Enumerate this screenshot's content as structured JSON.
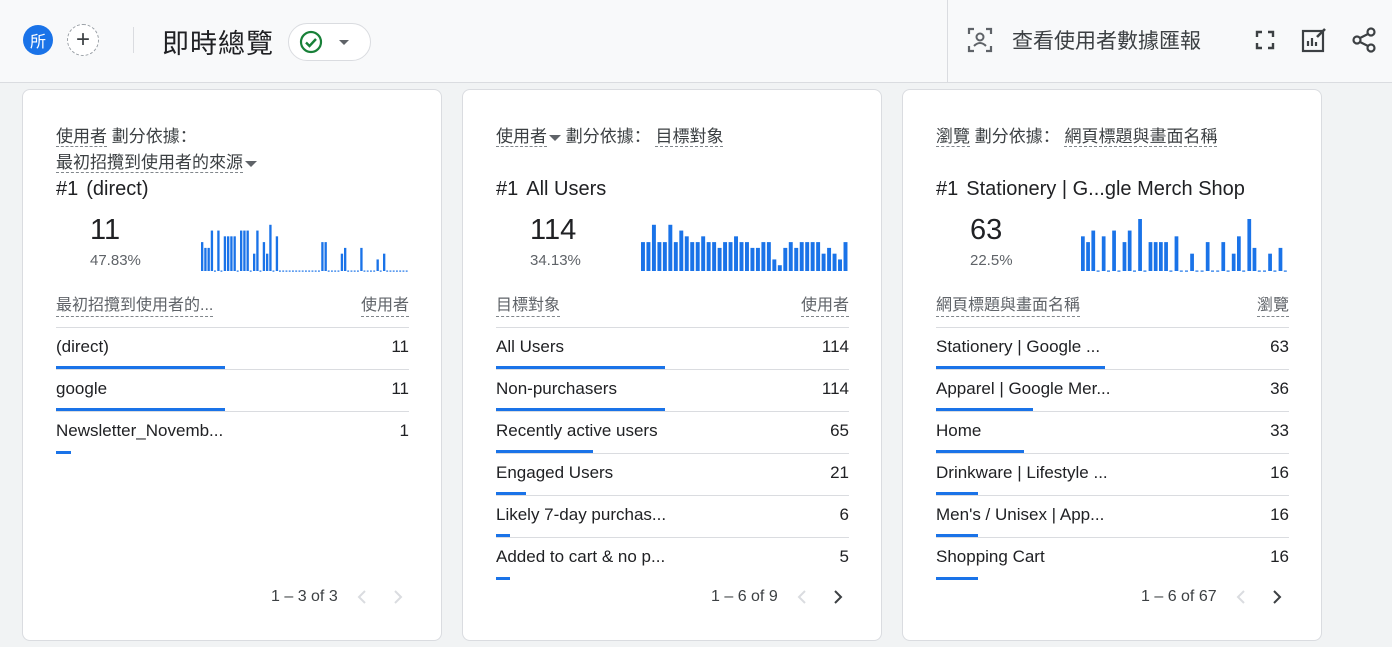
{
  "header": {
    "avatar_text": "所",
    "add_symbol": "+",
    "title": "即時總覽",
    "report_link": "查看使用者數據匯報"
  },
  "colors": {
    "accent": "#1a73e8",
    "check": "#188038"
  },
  "cards": [
    {
      "metric": "使用者",
      "split_label": "劃分依據：",
      "dimension": "最初招攬到使用者的來源",
      "rank": "#1",
      "top_name": "(direct)",
      "top_value": "11",
      "top_pct": "47.83%",
      "col_dim": "最初招攬到使用者的...",
      "col_metric": "使用者",
      "rows": [
        {
          "label": "(direct)",
          "value": "11",
          "share": 1.0
        },
        {
          "label": "google",
          "value": "11",
          "share": 1.0
        },
        {
          "label": "Newsletter_Novemb...",
          "value": "1",
          "share": 0.09
        }
      ],
      "pager": "1 – 3 of 3",
      "sparkline": [
        5,
        4,
        4,
        7,
        0,
        7,
        0,
        6,
        6,
        6,
        6,
        0,
        7,
        7,
        7,
        0,
        3,
        7,
        0,
        5,
        3,
        8,
        0,
        6,
        0,
        0,
        0,
        0,
        0,
        0,
        0,
        0,
        0,
        0,
        0,
        0,
        0,
        5,
        5,
        0,
        0,
        0,
        0,
        3,
        4,
        0,
        0,
        0,
        0,
        4,
        0,
        0,
        0,
        0,
        2,
        0,
        3,
        0,
        0,
        0,
        0,
        0,
        0,
        0
      ]
    },
    {
      "metric": "使用者",
      "split_label": "劃分依據：",
      "dimension": "目標對象",
      "rank": "#1",
      "top_name": "All Users",
      "top_value": "114",
      "top_pct": "34.13%",
      "col_dim": "目標對象",
      "col_metric": "使用者",
      "rows": [
        {
          "label": "All Users",
          "value": "114",
          "share": 1.0
        },
        {
          "label": "Non-purchasers",
          "value": "114",
          "share": 1.0
        },
        {
          "label": "Recently active users",
          "value": "65",
          "share": 0.57
        },
        {
          "label": "Engaged Users",
          "value": "21",
          "share": 0.18
        },
        {
          "label": "Likely 7-day purchas...",
          "value": "6",
          "share": 0.05
        },
        {
          "label": "Added to cart & no p...",
          "value": "5",
          "share": 0.04
        }
      ],
      "pager": "1 – 6 of 9",
      "sparkline": [
        5,
        5,
        8,
        5,
        5,
        8,
        5,
        7,
        6,
        5,
        5,
        6,
        5,
        5,
        4,
        5,
        5,
        6,
        5,
        5,
        4,
        4,
        5,
        5,
        2,
        1,
        4,
        5,
        4,
        5,
        5,
        5,
        5,
        3,
        4,
        3,
        2,
        5
      ]
    },
    {
      "metric": "瀏覽",
      "split_label": "劃分依據：",
      "dimension": "網頁標題與畫面名稱",
      "rank": "#1",
      "top_name": "Stationery | G...gle Merch Shop",
      "top_value": "63",
      "top_pct": "22.5%",
      "col_dim": "網頁標題與畫面名稱",
      "col_metric": "瀏覽",
      "rows": [
        {
          "label": "Stationery | Google ...",
          "value": "63",
          "share": 1.0
        },
        {
          "label": "Apparel | Google Mer...",
          "value": "36",
          "share": 0.57
        },
        {
          "label": "Home",
          "value": "33",
          "share": 0.52
        },
        {
          "label": "Drinkware | Lifestyle ...",
          "value": "16",
          "share": 0.25
        },
        {
          "label": "Men's / Unisex | App...",
          "value": "16",
          "share": 0.25
        },
        {
          "label": "Shopping Cart",
          "value": "16",
          "share": 0.25
        }
      ],
      "pager": "1 – 6 of 67",
      "sparkline": [
        6,
        5,
        7,
        0,
        6,
        0,
        7,
        0,
        5,
        7,
        0,
        9,
        0,
        5,
        5,
        5,
        5,
        0,
        6,
        0,
        0,
        3,
        0,
        0,
        5,
        0,
        0,
        5,
        0,
        3,
        6,
        0,
        9,
        4,
        0,
        0,
        3,
        0,
        4,
        0
      ]
    }
  ]
}
